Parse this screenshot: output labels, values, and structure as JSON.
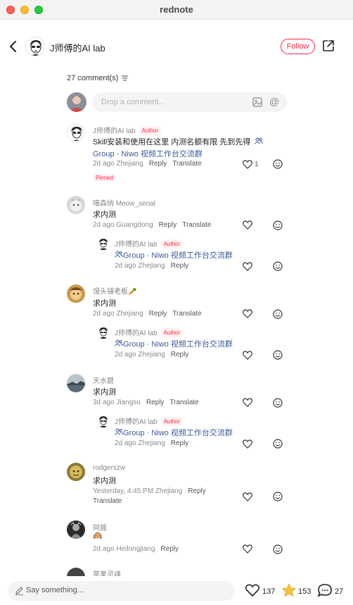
{
  "window": {
    "title": "rednote"
  },
  "header": {
    "author_name": "J师傅的AI lab",
    "follow_label": "Follow"
  },
  "comments_header": {
    "count_label": "27 comment(s)"
  },
  "input": {
    "placeholder": "Drop a comment..."
  },
  "comments": [
    {
      "user": "J师傅的AI lab",
      "badge": "Author",
      "text": "Skill安装和使用在这里 内测名额有限 先到先得",
      "group_text": "Group · Niwo 视频工作台交流群",
      "meta": "2d ago Zhejiang",
      "reply_label": "Reply",
      "translate_label": "Translate",
      "likes": "1",
      "pinned_label": "Pinned"
    },
    {
      "user": "喵森纳 Meow_senal",
      "text": "求内测",
      "meta": "2d ago Guangdong",
      "reply_label": "Reply",
      "translate_label": "Translate",
      "reply": {
        "user": "J师傅的AI lab",
        "badge": "Author",
        "group_text": "Group · Niwo 视频工作台交流群",
        "meta": "2d ago Zhejiang",
        "reply_label": "Reply"
      }
    },
    {
      "user": "馒头铺老板🥕",
      "text": "求内测",
      "meta": "2d ago Zhejiang",
      "reply_label": "Reply",
      "translate_label": "Translate",
      "reply": {
        "user": "J师傅的AI lab",
        "badge": "Author",
        "group_text": "Group · Niwo 视频工作台交流群",
        "meta": "2d ago Zhejiang",
        "reply_label": "Reply"
      }
    },
    {
      "user": "天水碧",
      "text": "求内测",
      "meta": "3d ago Jiangsu",
      "reply_label": "Reply",
      "translate_label": "Translate",
      "reply": {
        "user": "J师傅的AI lab",
        "badge": "Author",
        "group_text": "Group · Niwo 视频工作台交流群",
        "meta": "2d ago Zhejiang",
        "reply_label": "Reply"
      }
    },
    {
      "user": "rodgerszw",
      "text": "求内测",
      "meta": "Yesterday, 4:45 PM Zhejiang",
      "reply_label": "Reply",
      "translate_label": "Translate"
    },
    {
      "user": "阿聂",
      "text": "🙉",
      "meta": "2d ago Heilongjiang",
      "reply_label": "Reply"
    },
    {
      "user": "苹果灵魂"
    }
  ],
  "bottom_bar": {
    "say_placeholder": "Say something...",
    "likes": "137",
    "collects": "153",
    "comments": "27"
  },
  "colors": {
    "accent": "#ff2442",
    "link": "#3a5a9a",
    "star": "#f5c242"
  }
}
